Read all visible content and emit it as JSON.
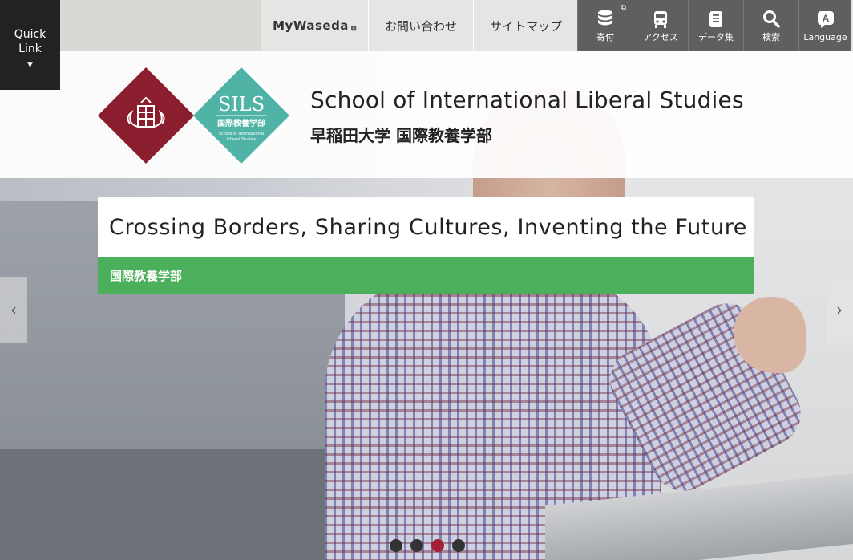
{
  "quick_link": {
    "label": "Quick\nLink",
    "arrow": "▼"
  },
  "topbar": {
    "text_links": [
      {
        "label": "MyWaseda",
        "external": "⧉"
      },
      {
        "label": "お問い合わせ"
      },
      {
        "label": "サイトマップ"
      }
    ],
    "icon_links": [
      {
        "label": "寄付",
        "icon": "database-icon",
        "external": "⧉"
      },
      {
        "label": "アクセス",
        "icon": "bus-icon"
      },
      {
        "label": "データ集",
        "icon": "book-icon"
      },
      {
        "label": "検索",
        "icon": "search-icon"
      },
      {
        "label": "Language",
        "icon": "language-icon",
        "glyph": "A"
      }
    ]
  },
  "branding": {
    "sils_logo_text": "SILS",
    "sils_logo_ja": "国際教養学部",
    "sils_logo_en_1": "School of International",
    "sils_logo_en_2": "Liberal Studies",
    "title_en": "School of International Liberal Studies",
    "title_ja": "早稲田大学 国際教養学部"
  },
  "hero": {
    "headline": "Crossing Borders, Sharing Cultures, Inventing the Future",
    "subline": "国際教養学部",
    "prev_arrow": "‹",
    "next_arrow": "›",
    "slides_count": 4,
    "active_slide": 3
  },
  "colors": {
    "waseda_red": "#8b1e2e",
    "sils_teal": "#4fb3a6",
    "accent_green": "#4caf5b",
    "icon_bar": "#5f5f5f"
  }
}
